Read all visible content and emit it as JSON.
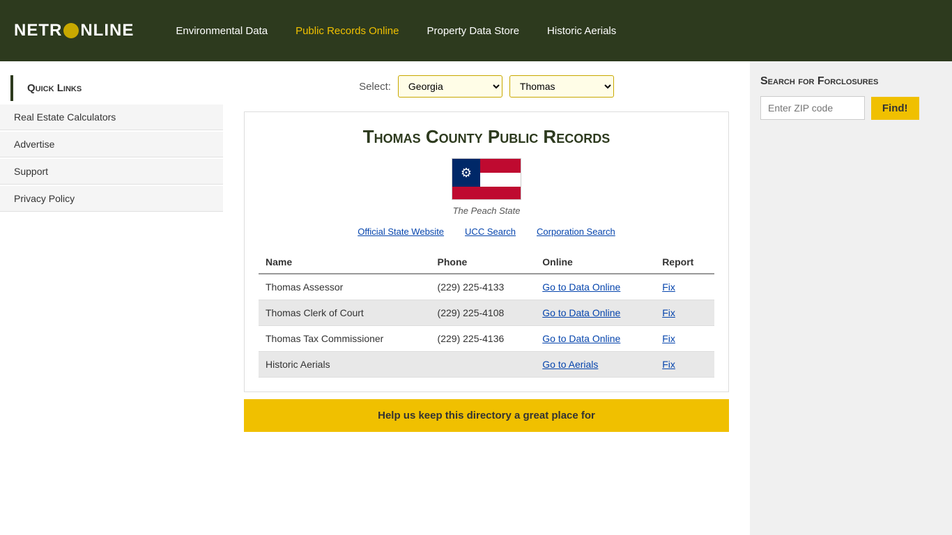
{
  "header": {
    "logo": "NETR●NLINE",
    "nav": [
      {
        "label": "Environmental Data",
        "active": false,
        "id": "env-data"
      },
      {
        "label": "Public Records Online",
        "active": true,
        "id": "pub-records"
      },
      {
        "label": "Property Data Store",
        "active": false,
        "id": "prop-data"
      },
      {
        "label": "Historic Aerials",
        "active": false,
        "id": "hist-aerials"
      }
    ]
  },
  "sidebar": {
    "title": "Quick Links",
    "items": [
      {
        "label": "Real Estate Calculators"
      },
      {
        "label": "Advertise"
      },
      {
        "label": "Support"
      },
      {
        "label": "Privacy Policy"
      }
    ]
  },
  "select_bar": {
    "label": "Select:",
    "state_value": "Georgia",
    "county_value": "Thomas"
  },
  "county": {
    "title": "Thomas County Public Records",
    "state_nickname": "The Peach State",
    "links": [
      {
        "label": "Official State Website"
      },
      {
        "label": "UCC Search"
      },
      {
        "label": "Corporation Search"
      }
    ]
  },
  "table": {
    "headers": [
      "Name",
      "Phone",
      "Online",
      "Report"
    ],
    "rows": [
      {
        "name": "Thomas Assessor",
        "phone": "(229) 225-4133",
        "online_label": "Go to Data Online",
        "report_label": "Fix",
        "shaded": false
      },
      {
        "name": "Thomas Clerk of Court",
        "phone": "(229) 225-4108",
        "online_label": "Go to Data Online",
        "report_label": "Fix",
        "shaded": true
      },
      {
        "name": "Thomas Tax Commissioner",
        "phone": "(229) 225-4136",
        "online_label": "Go to Data Online",
        "report_label": "Fix",
        "shaded": false
      },
      {
        "name": "Historic Aerials",
        "phone": "",
        "online_label": "Go to Aerials",
        "report_label": "Fix",
        "shaded": true
      }
    ]
  },
  "foreclosure": {
    "title": "Search for Forclosures",
    "zip_placeholder": "Enter ZIP code",
    "find_label": "Find!"
  },
  "bottom_banner": {
    "text": "Help us keep this directory a great place for"
  }
}
